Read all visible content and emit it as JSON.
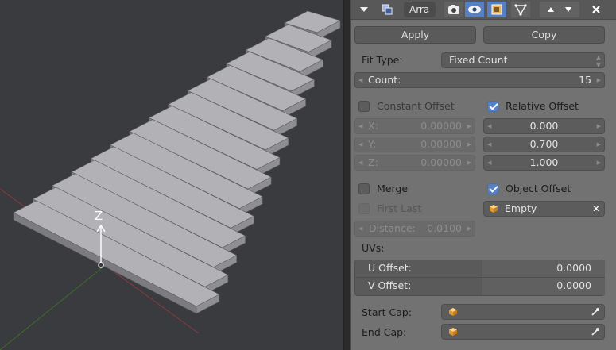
{
  "viewport": {
    "axis_label": "Z"
  },
  "header": {
    "modifier_name": "Arra",
    "icons": [
      "triangle-down-icon",
      "copy-icon",
      "camera-icon",
      "eye-icon",
      "editmode-icon",
      "vertex-icon",
      "arrow-up-icon",
      "arrow-down-icon",
      "close-icon"
    ]
  },
  "buttons": {
    "apply": "Apply",
    "copy": "Copy"
  },
  "fit": {
    "label": "Fit Type:",
    "value": "Fixed Count"
  },
  "count": {
    "label": "Count:",
    "value": "15"
  },
  "constant_offset": {
    "label": "Constant Offset",
    "checked": false,
    "x_label": "X:",
    "x": "0.00000",
    "y_label": "Y:",
    "y": "0.00000",
    "z_label": "Z:",
    "z": "0.00000"
  },
  "relative_offset": {
    "label": "Relative Offset",
    "checked": true,
    "x": "0.000",
    "y": "0.700",
    "z": "1.000"
  },
  "merge": {
    "label": "Merge",
    "checked": false
  },
  "first_last": {
    "label": "First Last",
    "checked": false
  },
  "distance": {
    "label": "Distance:",
    "value": "0.0100"
  },
  "object_offset": {
    "label": "Object Offset",
    "checked": true,
    "object": "Empty"
  },
  "uvs": {
    "label": "UVs:",
    "u_label": "U Offset:",
    "u_value": "0.0000",
    "v_label": "V Offset:",
    "v_value": "0.0000"
  },
  "caps": {
    "start_label": "Start Cap:",
    "end_label": "End Cap:"
  },
  "colors": {
    "accent": "#5680c2",
    "panel": "#727272",
    "viewport": "#393b3f"
  }
}
